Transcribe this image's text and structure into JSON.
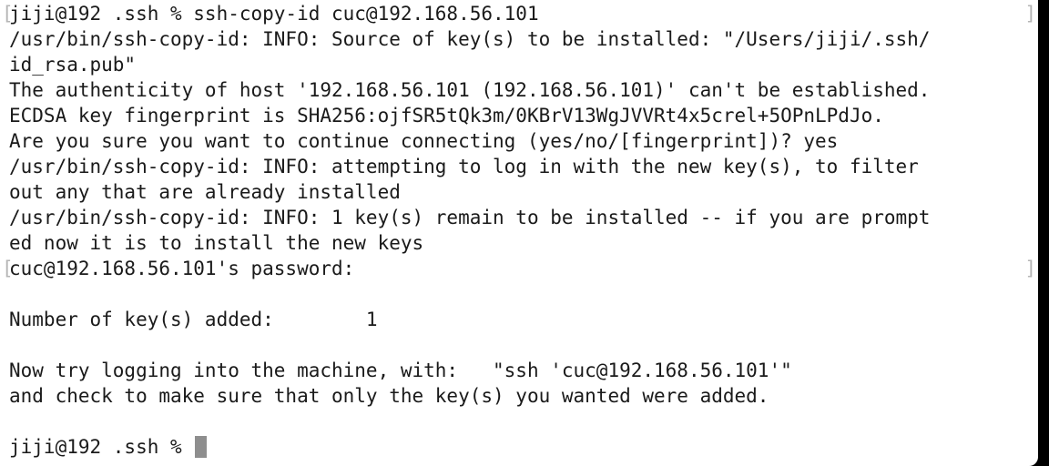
{
  "terminal": {
    "lines": [
      {
        "text": "jiji@192 .ssh % ssh-copy-id cuc@192.168.56.101",
        "marked": true
      },
      {
        "text": "/usr/bin/ssh-copy-id: INFO: Source of key(s) to be installed: \"/Users/jiji/.ssh/",
        "marked": false
      },
      {
        "text": "id_rsa.pub\"",
        "marked": false
      },
      {
        "text": "The authenticity of host '192.168.56.101 (192.168.56.101)' can't be established.",
        "marked": false
      },
      {
        "text": "ECDSA key fingerprint is SHA256:ojfSR5tQk3m/0KBrV13WgJVVRt4x5crel+5OPnLPdJo.",
        "marked": false
      },
      {
        "text": "Are you sure you want to continue connecting (yes/no/[fingerprint])? yes",
        "marked": false
      },
      {
        "text": "/usr/bin/ssh-copy-id: INFO: attempting to log in with the new key(s), to filter",
        "marked": false
      },
      {
        "text": "out any that are already installed",
        "marked": false
      },
      {
        "text": "/usr/bin/ssh-copy-id: INFO: 1 key(s) remain to be installed -- if you are prompt",
        "marked": false
      },
      {
        "text": "ed now it is to install the new keys",
        "marked": false
      },
      {
        "text": "cuc@192.168.56.101's password:",
        "marked": true
      },
      {
        "text": "",
        "marked": false
      },
      {
        "text": "Number of key(s) added:        1",
        "marked": false
      },
      {
        "text": "",
        "marked": false
      },
      {
        "text": "Now try logging into the machine, with:   \"ssh 'cuc@192.168.56.101'\"",
        "marked": false
      },
      {
        "text": "and check to make sure that only the key(s) you wanted were added.",
        "marked": false
      },
      {
        "text": "",
        "marked": false
      }
    ],
    "prompt": "jiji@192 .ssh % ",
    "mark_left": "[",
    "mark_right": "]",
    "colors": {
      "background": "#ffffff",
      "text": "#1a1a1a",
      "cursor": "#8e8e8e",
      "mark": "#b5b5b5"
    }
  }
}
